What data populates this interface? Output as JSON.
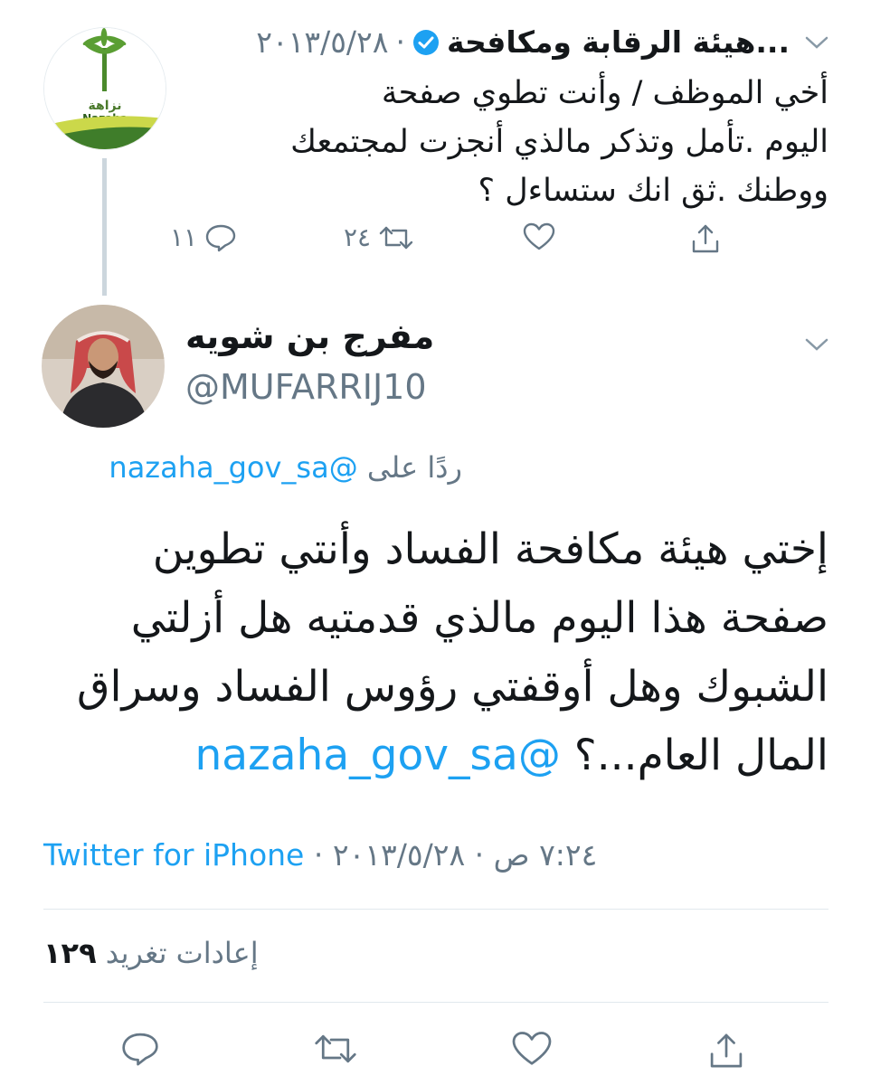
{
  "parent_tweet": {
    "author_name": "هيئة الرقابة ومكافحة...",
    "date": "٢٠١٣/٥/٢٨",
    "separator": "·",
    "text": "أخي الموظف / وأنت تطوي صفحة\nاليوم .تأمل وتذكر مالذي أنجزت لمجتمعك\nووطنك .ثق انك ستساءل ؟",
    "avatar_text_ar": "نزاهة",
    "avatar_text_en": "Nazaha",
    "replies_count": "١١",
    "retweets_count": "٢٤"
  },
  "main_tweet": {
    "author_name": "مفرج بن شويه",
    "handle": "@MUFARRIJ10",
    "reply_prefix": "ردًا على",
    "reply_to": "@nazaha_gov_sa",
    "text": "إختي هيئة مكافحة الفساد وأنتي تطوين صفحة هذا اليوم مالذي قدمتيه هل أزلتي الشبوك وهل أوقفتي رؤوس الفساد وسراق المال العام...؟",
    "text_mention": "@nazaha_gov_sa",
    "time": "٧:٢٤ ص",
    "date": "٢٠١٣/٥/٢٨",
    "separator": "·",
    "source": "Twitter for iPhone",
    "retweets_count": "١٢٩",
    "retweets_label": "إعادات تغريد"
  },
  "colors": {
    "link": "#1da1f2",
    "muted": "#657786",
    "verified": "#1da1f2",
    "divider": "#e1e8ed"
  },
  "icons": [
    "chevron-down-icon",
    "verified-icon",
    "reply-icon",
    "retweet-icon",
    "like-icon",
    "share-icon"
  ]
}
